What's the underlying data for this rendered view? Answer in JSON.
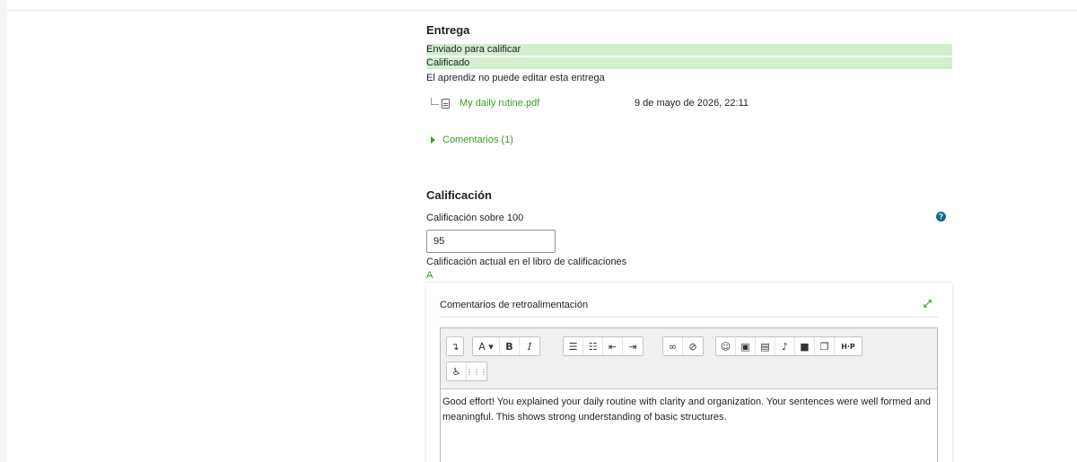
{
  "submission": {
    "heading": "Entrega",
    "status_submitted": "Enviado para calificar",
    "status_graded": "Calificado",
    "lock_notice": "El aprendiz no puede editar esta entrega",
    "file": {
      "name": "My daily rutine.pdf",
      "date": "9 de mayo de 2026, 22:11",
      "icon": "pdf-file-icon"
    },
    "comments_toggle": "Comentarios (1)"
  },
  "grading": {
    "heading": "Calificación",
    "grade_label": "Calificación sobre 100",
    "grade_value": "95",
    "gradebook_label": "Calificación actual en el libro de calificaciones",
    "gradebook_value": "A",
    "help_icon": "?"
  },
  "feedback": {
    "title": "Comentarios de retroalimentación",
    "expand_icon": "fullscreen-icon",
    "toolbar": {
      "row1": [
        [
          "↴"
        ],
        [
          "A ▾",
          "B",
          "I"
        ],
        [
          "☰",
          "☷",
          "⇤",
          "⇥"
        ],
        [
          "∞",
          "⊘"
        ],
        [
          "☺",
          "▣",
          "▤",
          "♪",
          "■",
          "❐",
          "H·P"
        ]
      ],
      "row2": [
        [
          "♿",
          "⋮⋮⋮"
        ]
      ]
    },
    "text": "Good effort! You explained your daily routine with clarity and organization. Your sentences were well formed and meaningful. This shows strong understanding of basic structures."
  },
  "colors": {
    "accent_green": "#3c9a2a",
    "status_bg": "#d2eecf",
    "help_blue": "#0f6e8a"
  }
}
